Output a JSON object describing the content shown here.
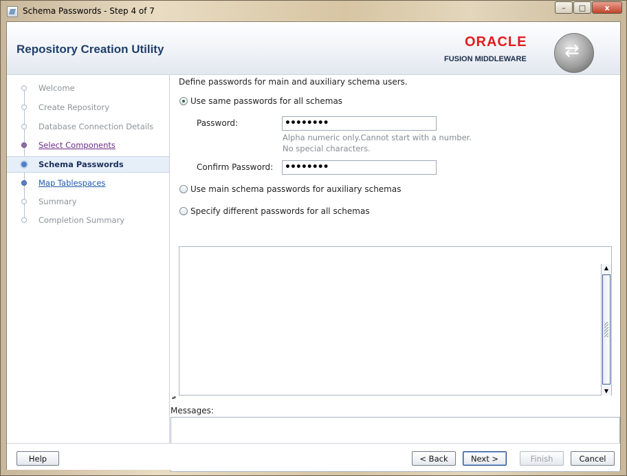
{
  "window": {
    "title": "Schema Passwords - Step 4 of 7",
    "minimize": "–",
    "maximize": "□",
    "close": "x"
  },
  "header": {
    "app_title": "Repository Creation Utility",
    "brand_name": "ORACLE",
    "brand_sub": "FUSION MIDDLEWARE"
  },
  "nav": {
    "items": [
      {
        "label": "Welcome",
        "state": "inactive"
      },
      {
        "label": "Create Repository",
        "state": "inactive"
      },
      {
        "label": "Database Connection Details",
        "state": "inactive"
      },
      {
        "label": "Select Components",
        "state": "visited"
      },
      {
        "label": "Schema Passwords",
        "state": "current"
      },
      {
        "label": "Map Tablespaces",
        "state": "link"
      },
      {
        "label": "Summary",
        "state": "inactive"
      },
      {
        "label": "Completion Summary",
        "state": "inactive"
      }
    ]
  },
  "main": {
    "intro": "Define passwords for main and auxiliary schema users.",
    "option_same": "Use same passwords for all schemas",
    "password_label": "Password:",
    "password_value": "••••••••",
    "hint_line1": "Alpha numeric only.Cannot start with a number.",
    "hint_line2": "No special characters.",
    "confirm_label": "Confirm Password:",
    "confirm_value": "••••••••",
    "option_main": "Use main schema passwords for auxiliary schemas",
    "option_different": "Specify different passwords for all schemas",
    "selected_option": "same"
  },
  "messages": {
    "label": "Messages:"
  },
  "footer": {
    "help": "Help",
    "back": "< Back",
    "next": "Next >",
    "finish": "Finish",
    "cancel": "Cancel"
  }
}
